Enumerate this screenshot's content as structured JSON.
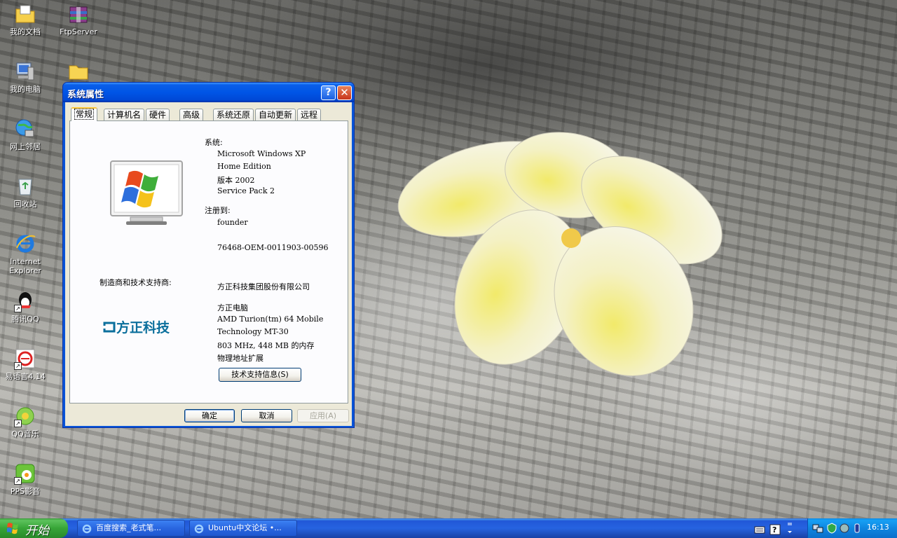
{
  "desktop": {
    "icons": [
      {
        "label": "我的文档",
        "icon": "my-documents-icon"
      },
      {
        "label": "FtpServer",
        "icon": "archive-icon"
      },
      {
        "label": "我的电脑",
        "icon": "my-computer-icon"
      },
      {
        "label": "",
        "icon": "folder-icon"
      },
      {
        "label": "网上邻居",
        "icon": "network-places-icon"
      },
      {
        "label": "回收站",
        "icon": "recycle-bin-icon"
      },
      {
        "label": "Internet\nExplorer",
        "label_line1": "Internet",
        "label_line2": "Explorer",
        "icon": "internet-explorer-icon"
      },
      {
        "label": "腾讯QQ",
        "icon": "qq-icon"
      },
      {
        "label": "易语言4.14",
        "icon": "eyuyan-icon"
      },
      {
        "label": "QQ音乐",
        "icon": "qq-music-icon"
      },
      {
        "label": "PPS影音",
        "icon": "pps-icon"
      }
    ]
  },
  "window": {
    "title": "系统属性",
    "help_glyph": "?",
    "close_glyph": "✕",
    "tabs": [
      "常规",
      "计算机名",
      "硬件",
      "高级",
      "系统还原",
      "自动更新",
      "远程"
    ],
    "active_tab": "常规",
    "system_heading": "系统:",
    "system_lines": [
      "Microsoft Windows XP",
      "Home Edition",
      "版本 2002",
      "Service Pack 2"
    ],
    "registered_heading": "注册到:",
    "registered_user": "founder",
    "product_id": "76468-OEM-0011903-00596",
    "manufacturer_heading": "制造商和技术支持商:",
    "manufacturer_name": "方正科技集团股份有限公司",
    "manufacturer_logo_text": "方正科技",
    "hardware_lines": [
      "方正电脑",
      "AMD Turion(tm) 64 Mobile",
      "Technology MT-30",
      "803 MHz, 448 MB 的内存",
      "物理地址扩展"
    ],
    "support_button": "技术支持信息(S)",
    "ok_button": "确定",
    "cancel_button": "取消",
    "apply_button": "应用(A)"
  },
  "taskbar": {
    "start_label": "开始",
    "items": [
      {
        "label": "百度搜索_老式笔..."
      },
      {
        "label": "Ubuntu中文论坛 •..."
      }
    ],
    "clock": "16:13",
    "colors": {
      "taskbar": "#2663e0",
      "start": "#37a537",
      "tray": "#0f86e0"
    }
  }
}
